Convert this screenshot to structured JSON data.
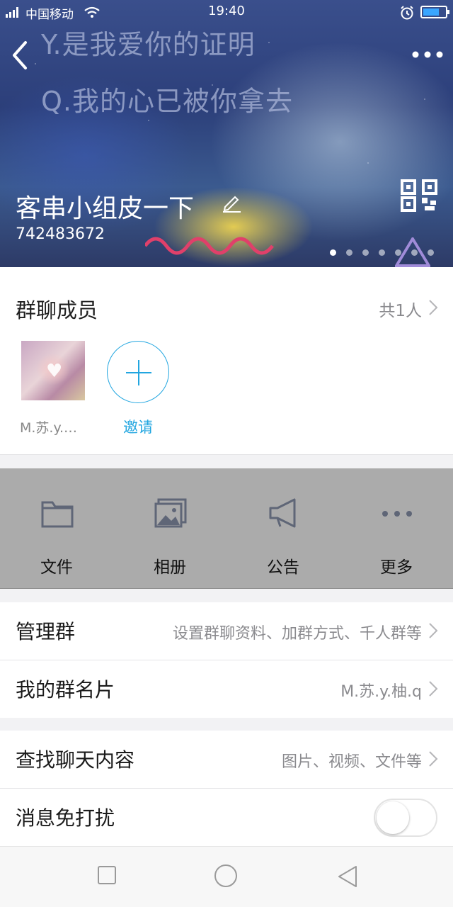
{
  "status_bar": {
    "carrier": "中国移动",
    "time": "19:40",
    "battery_color": "#3aa6ff"
  },
  "header": {
    "cover_lyrics": [
      "Y.是我爱你的证明",
      "Q.我的心已被你拿去"
    ],
    "group_name": "客串小组皮一下",
    "group_id": "742483672",
    "page_count": 7,
    "active_page": 1,
    "icons": [
      "back-arrow-icon",
      "more-dots-icon",
      "edit-pencil-icon",
      "qr-code-icon"
    ]
  },
  "members": {
    "title": "群聊成员",
    "count": "共1人",
    "list": [
      {
        "name": "M.苏.y.…"
      }
    ],
    "invite_label": "邀请",
    "accent_color": "#22a6e0"
  },
  "actions": [
    {
      "label": "文件",
      "icon": "folder-icon"
    },
    {
      "label": "相册",
      "icon": "album-icon"
    },
    {
      "label": "公告",
      "icon": "megaphone-icon"
    },
    {
      "label": "更多",
      "icon": "more-dots-icon"
    }
  ],
  "settings": {
    "manage": {
      "title": "管理群",
      "value": "设置群聊资料、加群方式、千人群等"
    },
    "card": {
      "title": "我的群名片",
      "value": "M.苏.y.柚.q"
    },
    "search": {
      "title": "查找聊天内容",
      "value": "图片、视频、文件等"
    },
    "mute": {
      "title": "消息免打扰",
      "enabled": false
    }
  },
  "nav_bar": {
    "icons": [
      "square-recents-icon",
      "circle-home-icon",
      "triangle-back-icon"
    ]
  }
}
